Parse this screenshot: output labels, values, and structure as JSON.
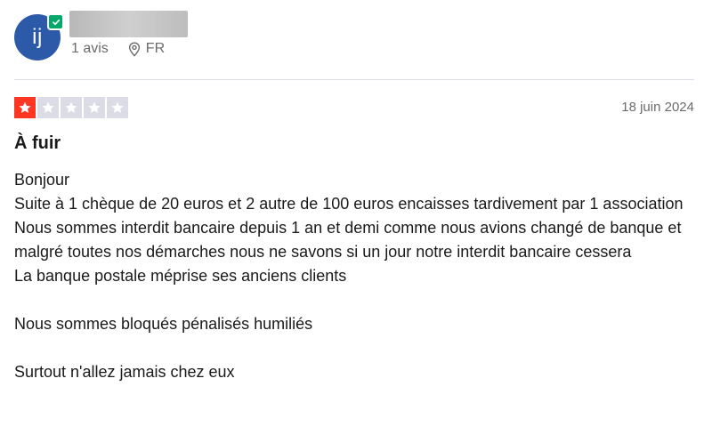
{
  "reviewer": {
    "initials": "ij",
    "review_count": "1 avis",
    "country": "FR",
    "verified": true
  },
  "review": {
    "rating": 1,
    "max_rating": 5,
    "date": "18 juin 2024",
    "title": "À fuir",
    "body": {
      "line1": "Bonjour",
      "line2": "Suite à 1 chèque de 20 euros et 2 autre de 100 euros encaisses tardivement par 1 association",
      "line3": "Nous sommes interdit bancaire depuis 1 an et demi comme nous avions changé de banque et malgré toutes nos démarches nous ne savons si un jour notre interdit bancaire cessera",
      "line4": "La banque postale méprise ses anciens clients",
      "line5": "Nous sommes bloqués pénalisés humiliés",
      "line6": "Surtout n'allez jamais chez eux"
    }
  },
  "colors": {
    "avatar": "#2d5aa8",
    "badge": "#04a86b",
    "star_filled": "#ff3722",
    "star_empty": "#dcdce6"
  },
  "icons": {
    "verified": "check-badge-icon",
    "location": "location-pin-icon",
    "star": "star-icon"
  }
}
